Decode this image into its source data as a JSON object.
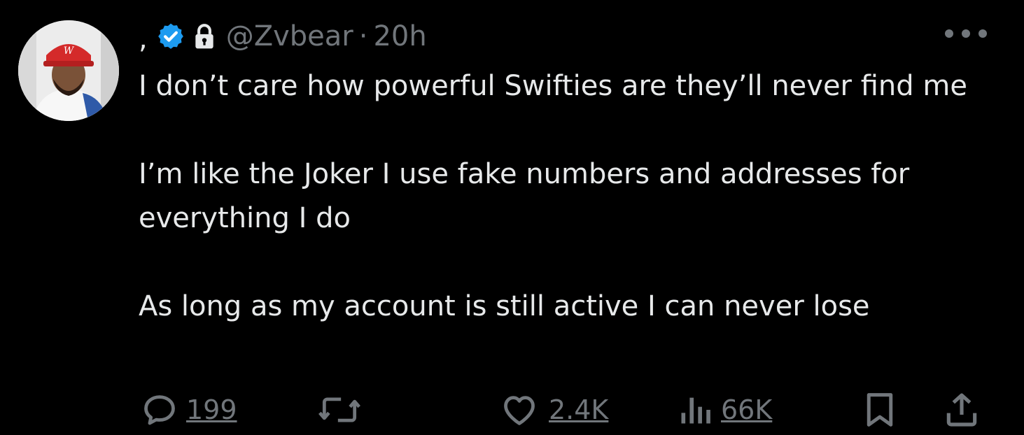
{
  "tweet": {
    "display_name": ",",
    "handle": "@Zvbear",
    "separator": "·",
    "time": "20h",
    "paragraphs": [
      "I don’t care how powerful Swifties are they’ll never find me",
      "I’m like the Joker I use fake numbers and addresses for everything I do",
      "As long as my account is still active I can never lose"
    ]
  },
  "actions": {
    "reply": {
      "icon": "reply-icon",
      "count": "199"
    },
    "retweet": {
      "icon": "retweet-icon"
    },
    "like": {
      "icon": "heart-icon",
      "count": "2.4K"
    },
    "views": {
      "icon": "views-icon",
      "count": "66K"
    },
    "bookmark": {
      "icon": "bookmark-icon"
    },
    "share": {
      "icon": "share-icon"
    }
  },
  "colors": {
    "background": "#000000",
    "text": "#e7e9ea",
    "muted": "#71767b",
    "verified": "#1d9bf0"
  }
}
